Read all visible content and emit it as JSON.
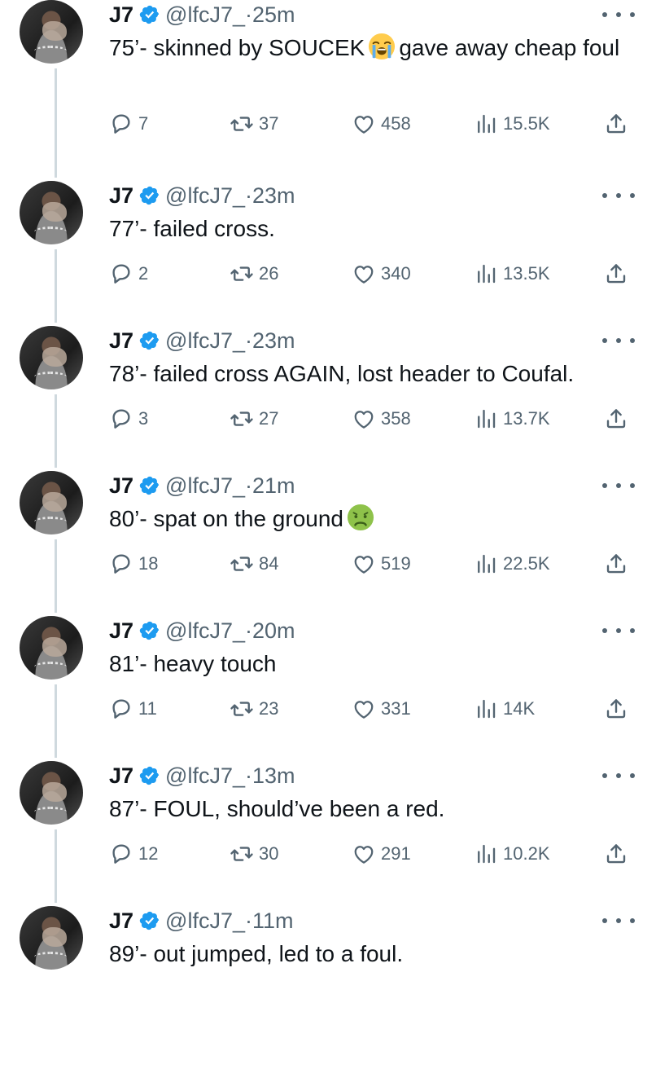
{
  "author": {
    "name": "J7",
    "handle": "@lfcJ7_",
    "verified": true
  },
  "colors": {
    "text": "#0f1419",
    "secondary": "#536471",
    "verified_blue": "#1d9bf0",
    "thread_line": "#cfd9de"
  },
  "tweets": [
    {
      "time": "·25m",
      "text": "75’- skinned by SOUCEK",
      "emoji": "loudly-crying-face",
      "text_after": "gave away cheap foul",
      "replies": "7",
      "reposts": "37",
      "likes": "458",
      "views": "15.5K"
    },
    {
      "time": "·23m",
      "text": "77’- failed cross.",
      "replies": "2",
      "reposts": "26",
      "likes": "340",
      "views": "13.5K"
    },
    {
      "time": "·23m",
      "text": "78’- failed cross AGAIN, lost header to Coufal.",
      "replies": "3",
      "reposts": "27",
      "likes": "358",
      "views": "13.7K"
    },
    {
      "time": "·21m",
      "text": "80’- spat on the ground",
      "emoji": "nauseated-face",
      "replies": "18",
      "reposts": "84",
      "likes": "519",
      "views": "22.5K"
    },
    {
      "time": "·20m",
      "text": "81’- heavy touch",
      "replies": "11",
      "reposts": "23",
      "likes": "331",
      "views": "14K"
    },
    {
      "time": "·13m",
      "text": "87’- FOUL, should’ve been a red.",
      "replies": "12",
      "reposts": "30",
      "likes": "291",
      "views": "10.2K"
    },
    {
      "time": "·11m",
      "text": "89’- out jumped, led to a foul."
    }
  ]
}
